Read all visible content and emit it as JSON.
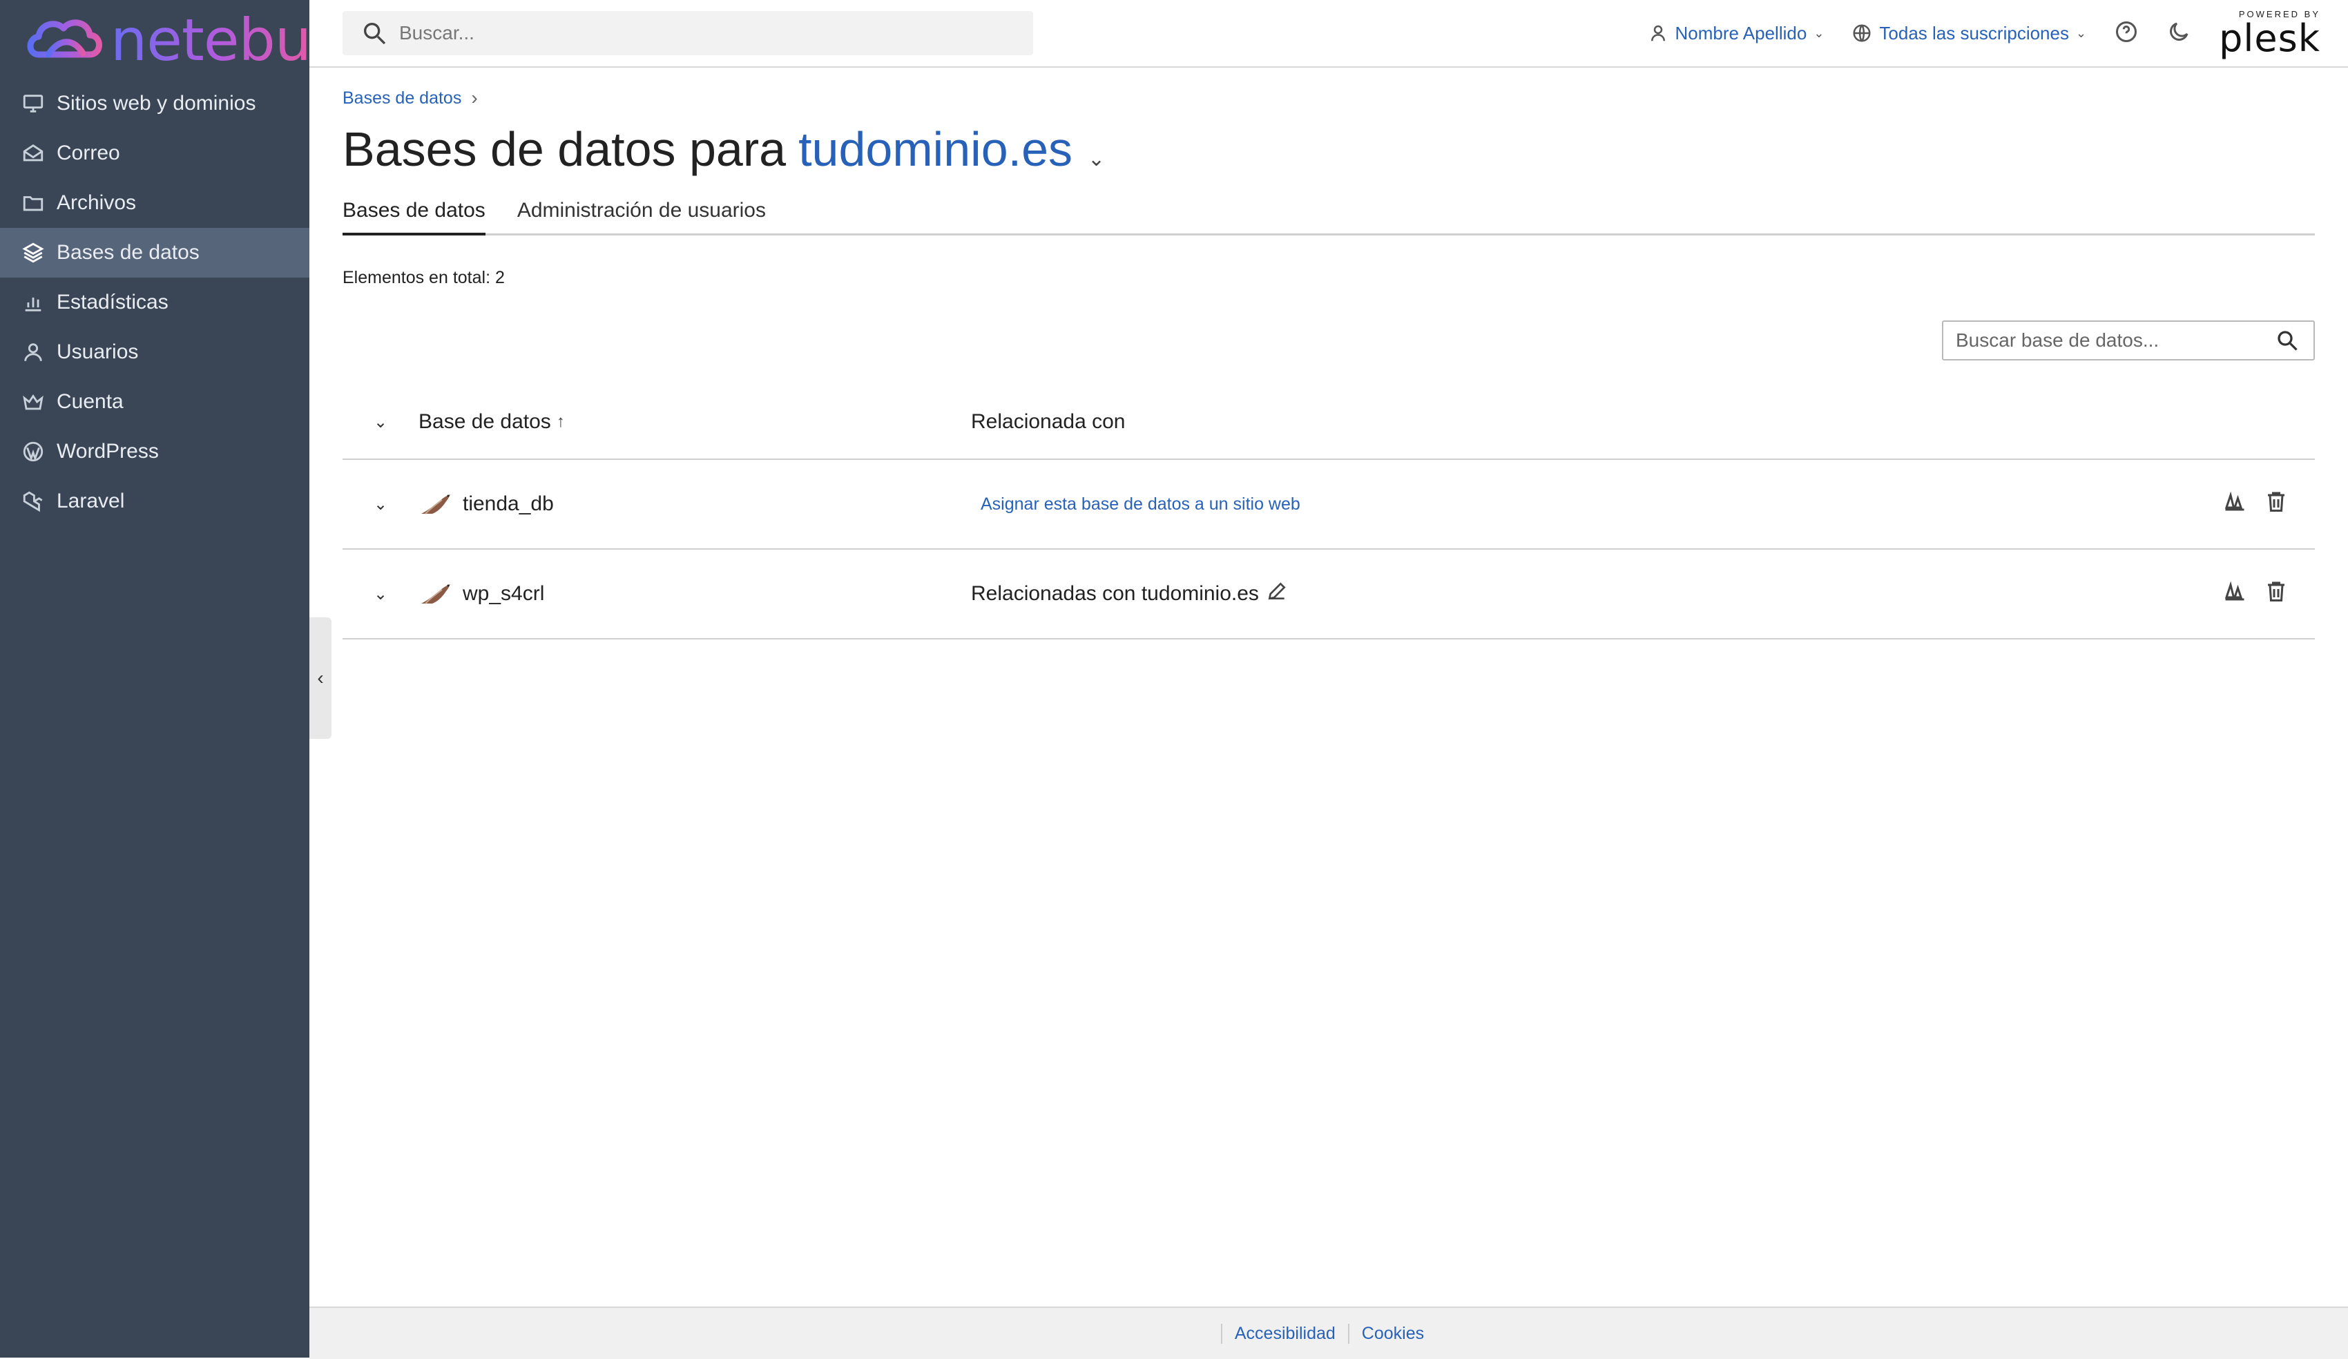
{
  "brand": {
    "name": "netebu",
    "icon": "cloud-logo",
    "colors": {
      "sidebar_bg": "#3a4656",
      "sidebar_active": "#56657a",
      "accent": "#2862b8"
    }
  },
  "sidebar": {
    "items": [
      {
        "label": "Sitios web y dominios",
        "icon": "monitor-icon"
      },
      {
        "label": "Correo",
        "icon": "mail-icon"
      },
      {
        "label": "Archivos",
        "icon": "folder-icon"
      },
      {
        "label": "Bases de datos",
        "icon": "database-layers-icon",
        "active": true
      },
      {
        "label": "Estadísticas",
        "icon": "bar-chart-icon"
      },
      {
        "label": "Usuarios",
        "icon": "user-icon"
      },
      {
        "label": "Cuenta",
        "icon": "crown-icon"
      },
      {
        "label": "WordPress",
        "icon": "wordpress-icon"
      },
      {
        "label": "Laravel",
        "icon": "laravel-icon"
      }
    ]
  },
  "topbar": {
    "search_placeholder": "Buscar...",
    "user_name": "Nombre Apellido",
    "subscriptions": "Todas las suscripciones",
    "plesk_small": "POWERED BY",
    "plesk_big": "plesk"
  },
  "main": {
    "breadcrumb": "Bases de datos",
    "title_prefix": "Bases de datos para",
    "title_domain": "tudominio.es",
    "tabs": [
      {
        "label": "Bases de datos",
        "active": true
      },
      {
        "label": "Administración de usuarios",
        "active": false
      }
    ],
    "total_label": "Elementos en total: 2",
    "db_search_placeholder": "Buscar base de datos...",
    "columns": {
      "name": "Base de datos",
      "related": "Relacionada con"
    },
    "rows": [
      {
        "name": "tienda_db",
        "related_link": "Asignar esta base de datos a un sitio web",
        "related_text": ""
      },
      {
        "name": "wp_s4crl",
        "related_link": "",
        "related_text": "Relacionadas con tudominio.es"
      }
    ]
  },
  "footer": {
    "links": [
      "Accesibilidad",
      "Cookies"
    ]
  }
}
